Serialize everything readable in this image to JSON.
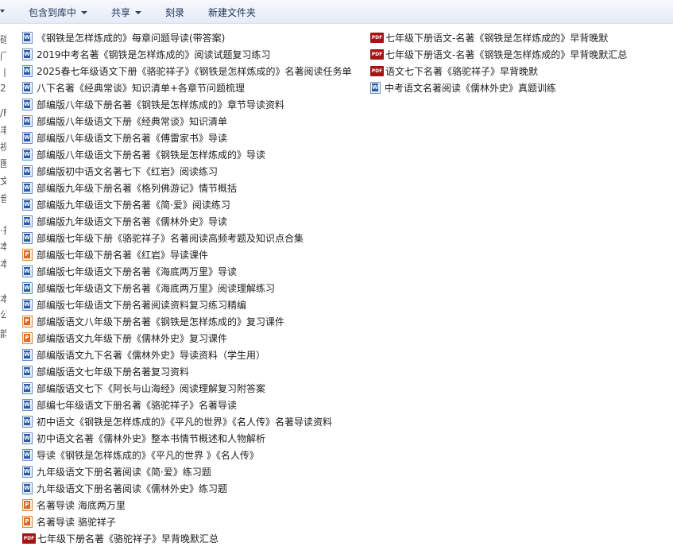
{
  "toolbar": {
    "include_library": "包含到库中",
    "share": "共享",
    "burn": "刻录",
    "new_folder": "新建文件夹"
  },
  "nav_fragments": [
    "碹",
    "门",
    "丨",
    "2",
    "/F",
    "丰",
    "视",
    "图",
    "文",
    "音",
    "·打",
    "本",
    "本",
    "本",
    "公",
    "韵"
  ],
  "files_left": [
    {
      "name": "《钢铁是怎样炼成的》每章问题导读(带答案)",
      "type": "word-icon"
    },
    {
      "name": "2019中考名著《钢铁是怎样炼成的》阅读试题复习练习",
      "type": "word-icon"
    },
    {
      "name": "2025春七年级语文下册《骆驼祥子》《钢铁是怎样炼成的》名著阅读任务单",
      "type": "word-icon"
    },
    {
      "name": "八下名著《经典常谈》知识清单+各章节问题梳理",
      "type": "word-icon"
    },
    {
      "name": "部编版八年级下册名著《钢铁是怎样炼成的》章节导读资料",
      "type": "word-icon"
    },
    {
      "name": "部编版八年级语文下册《经典常谈》知识清单",
      "type": "word-icon"
    },
    {
      "name": "部编版八年级语文下册名著《傅雷家书》导读",
      "type": "word-icon"
    },
    {
      "name": "部编版八年级语文下册名著《钢铁是怎样炼成的》导读",
      "type": "word-icon"
    },
    {
      "name": "部编版初中语文名著七下《红岩》阅读练习",
      "type": "word-icon"
    },
    {
      "name": "部编版九年级下册名著《格列佛游记》情节概括",
      "type": "word-icon"
    },
    {
      "name": "部编版九年级语文下册名著《简·爱》阅读练习",
      "type": "word-icon"
    },
    {
      "name": "部编版九年级语文下册名著《儒林外史》导读",
      "type": "word-icon"
    },
    {
      "name": "部编版七年级下册《骆驼祥子》名著阅读高频考题及知识点合集",
      "type": "word-icon"
    },
    {
      "name": "部编版七年级下册名著《红岩》导读课件",
      "type": "ppt-icon"
    },
    {
      "name": "部编版七年级语文下册名著《海底两万里》导读",
      "type": "word-icon"
    },
    {
      "name": "部编版七年级语文下册名著《海底两万里》阅读理解练习",
      "type": "word-icon"
    },
    {
      "name": "部编版七年级语文下册名著阅读资料复习练习精编",
      "type": "word-icon"
    },
    {
      "name": "部编版语文八年级下册名著《钢铁是怎样炼成的》复习课件",
      "type": "ppt-icon"
    },
    {
      "name": "部编版语文九年级下册《儒林外史》复习课件",
      "type": "ppt-icon"
    },
    {
      "name": "部编版语文九下名著《儒林外史》导读资料（学生用）",
      "type": "word-icon"
    },
    {
      "name": "部编版语文七年级下册名著复习资料",
      "type": "word-icon"
    },
    {
      "name": "部编版语文七下《阿长与山海经》阅读理解复习附答案",
      "type": "word-icon"
    },
    {
      "name": "部编七年级语文下册名著《骆驼祥子》名著导读",
      "type": "word-icon"
    },
    {
      "name": "初中语文《钢铁是怎样炼成的》《平凡的世界》《名人传》名著导读资料",
      "type": "word-icon"
    },
    {
      "name": "初中语文名著《儒林外史》整本书情节概述和人物解析",
      "type": "word-icon"
    },
    {
      "name": "导读《钢铁是怎样炼成的》《平凡的世界 》《名人传》",
      "type": "word-icon"
    },
    {
      "name": "九年级语文下册名著阅读《简·爱》练习题",
      "type": "word-icon"
    },
    {
      "name": "九年级语文下册名著阅读《儒林外史》练习题",
      "type": "word-icon"
    },
    {
      "name": "名著导读 海底两万里",
      "type": "ppt-icon"
    },
    {
      "name": "名著导读 骆驼祥子",
      "type": "ppt-icon"
    },
    {
      "name": "七年级下册名著《骆驼祥子》早背晚默汇总",
      "type": "pdf-icon"
    }
  ],
  "files_right": [
    {
      "name": "七年级下册语文-名著《钢铁是怎样炼成的》早背晚默",
      "type": "pdf-icon"
    },
    {
      "name": "七年级下册语文-名著《钢铁是怎样炼成的》早背晚默汇总",
      "type": "pdf-icon"
    },
    {
      "name": "语文七下名著《骆驼祥子》早背晚默",
      "type": "pdf-icon"
    },
    {
      "name": "中考语文名著阅读《儒林外史》真题训练",
      "type": "word-icon"
    }
  ]
}
